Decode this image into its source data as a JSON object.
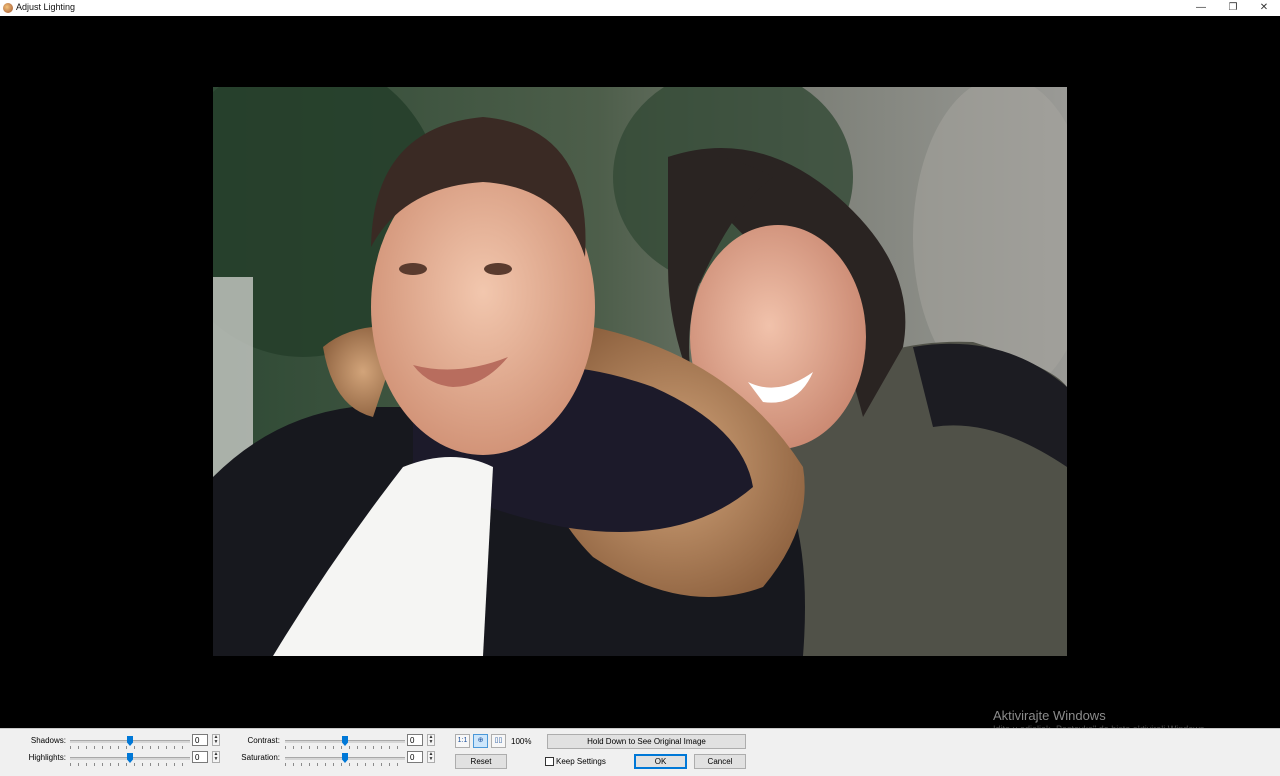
{
  "window": {
    "title": "Adjust Lighting",
    "minimize": "—",
    "restore": "❐",
    "close": "✕"
  },
  "controls": {
    "shadows": {
      "label": "Shadows:",
      "value": "0",
      "level": 0.5
    },
    "highlights": {
      "label": "Highlights:",
      "value": "0",
      "level": 0.5
    },
    "contrast": {
      "label": "Contrast:",
      "value": "0",
      "level": 0.5
    },
    "saturation": {
      "label": "Saturation:",
      "value": "0",
      "level": 0.5
    }
  },
  "view": {
    "actual_size": "1:1",
    "fit": "⊕",
    "compare": "▯▯",
    "zoom": "100%"
  },
  "buttons": {
    "reset": "Reset",
    "hold_original": "Hold Down to See Original Image",
    "keep_settings": "Keep Settings",
    "ok": "OK",
    "cancel": "Cancel"
  },
  "watermark": {
    "line1": "Aktivirajte Windows",
    "line2": "Idite u odjeljak „Postavke\" da biste aktivirali Windows."
  },
  "colors": {
    "accent": "#0078d7"
  }
}
